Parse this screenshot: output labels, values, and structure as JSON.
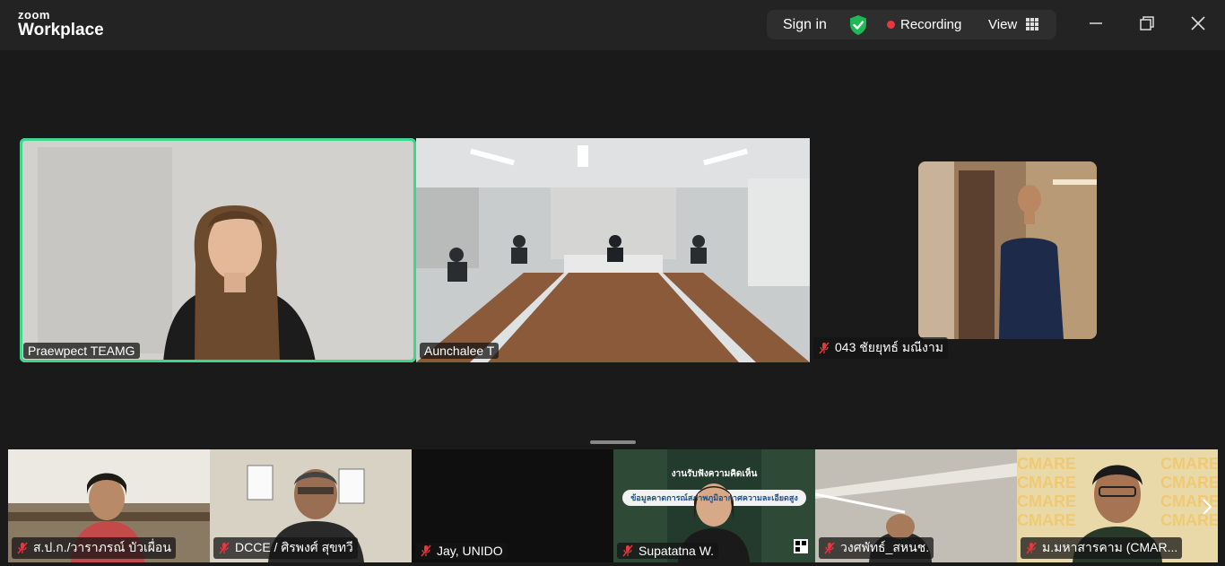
{
  "app": {
    "brand_top": "zoom",
    "brand_bottom": "Workplace"
  },
  "titlebar": {
    "sign_in": "Sign in",
    "recording": "Recording",
    "view": "View",
    "icons": [
      "shield-check-icon",
      "recording-dot-icon",
      "grid-icon",
      "minimize-icon",
      "restore-icon",
      "close-icon"
    ],
    "accent": "#3dd68c"
  },
  "main_tiles": [
    {
      "name": "Praewpect TEAMG",
      "muted": false,
      "active": true
    },
    {
      "name": "Aunchalee T",
      "muted": false,
      "active": false
    },
    {
      "name": "043 ชัยยุทธ์ มณีงาม",
      "muted": true,
      "active": false
    }
  ],
  "strip_tiles": [
    {
      "name": "ส.ป.ก./วาราภรณ์ บัวเผื่อน",
      "muted": true
    },
    {
      "name": "DCCE / ศิรพงศ์ สุขทวี",
      "muted": true
    },
    {
      "name": "Jay, UNIDO",
      "muted": true
    },
    {
      "name": "Supatatna W.",
      "muted": true
    },
    {
      "name": "วงศพัทธ์_สหนช.",
      "muted": true
    },
    {
      "name": "ม.มหาสารคาม (CMAR...",
      "muted": true
    }
  ],
  "slide": {
    "line1": "งานรับฟังความคิดเห็น",
    "line2": "ข้อมูลคาดการณ์สภาพภูมิอากาศความละเอียดสูง"
  },
  "cmare_text": "CMARE"
}
